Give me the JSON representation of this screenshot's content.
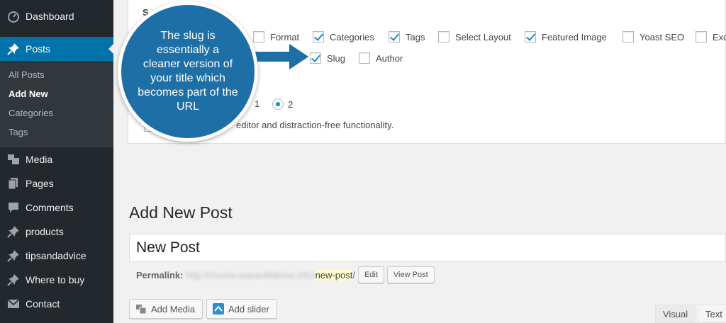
{
  "sidebar": {
    "items": [
      {
        "label": "Dashboard",
        "icon": "dashboard-icon"
      },
      {
        "label": "Posts",
        "icon": "pin-icon"
      },
      {
        "label": "Media",
        "icon": "media-icon"
      },
      {
        "label": "Pages",
        "icon": "pages-icon"
      },
      {
        "label": "Comments",
        "icon": "comment-icon"
      },
      {
        "label": "products",
        "icon": "pin-icon"
      },
      {
        "label": "tipsandadvice",
        "icon": "pin-icon"
      },
      {
        "label": "Where to buy",
        "icon": "pin-icon"
      },
      {
        "label": "Contact",
        "icon": "mail-icon"
      }
    ],
    "submenu": [
      "All Posts",
      "Add New",
      "Categories",
      "Tags"
    ]
  },
  "screen_options": {
    "heading_partial": "S",
    "row1": [
      {
        "label": "Format",
        "checked": false
      },
      {
        "label": "Categories",
        "checked": true
      },
      {
        "label": "Tags",
        "checked": true
      },
      {
        "label": "Select Layout",
        "checked": false
      },
      {
        "label": "Featured Image",
        "checked": true
      },
      {
        "label": "Yoast SEO",
        "checked": false
      },
      {
        "label": "Exc",
        "checked": false
      }
    ],
    "row2": [
      {
        "label": "Slug",
        "checked": true
      },
      {
        "label": "Author",
        "checked": false
      }
    ],
    "columns": [
      {
        "label": "1",
        "checked": false
      },
      {
        "label": "2",
        "checked": true
      }
    ],
    "editor_text": "editor and distraction-free functionality."
  },
  "callout": {
    "text": "The slug is essentially a cleaner version of your title which becomes part of the URL"
  },
  "main": {
    "title": "Add New Post",
    "post_title_value": "New Post",
    "permalink_label": "Permalink:",
    "permalink_url": "http://mumw.wasaofitdemo.info/",
    "permalink_slug": "new-post",
    "permalink_trailing": "/",
    "edit_button": "Edit",
    "view_button": "View Post",
    "add_media": "Add Media",
    "add_slider": "Add slider",
    "tab_visual": "Visual",
    "tab_text": "Text"
  },
  "colors": {
    "sidebar_bg": "#23282d",
    "active_blue": "#0073aa",
    "callout_blue": "#1d6fa5"
  }
}
